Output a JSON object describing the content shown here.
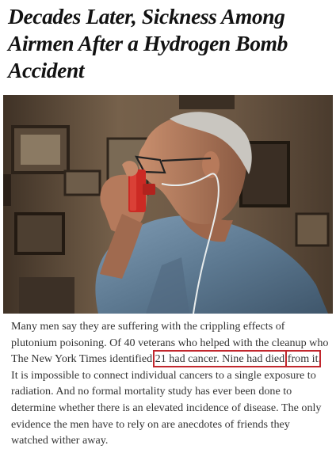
{
  "article": {
    "headline": "Decades Later, Sickness Among Airmen After a Hydrogen Bomb Accident",
    "photo": {
      "subject": "older-man-using-inhaler",
      "icon": "inhaler-icon",
      "colors": {
        "background": "#5e4a38",
        "shirt": "#5f7b93",
        "inhaler": "#cc2a24",
        "highlight_box": "#c1272d"
      }
    },
    "body": {
      "text_before": "Many men say they are suffering with the crippling effects of plutonium poisoning. Of 40 veterans who helped with the cleanup who The New York Times identified ",
      "highlight_1": "21 had cancer. Nine had died",
      "text_between": " ",
      "highlight_2": "from it",
      "text_after": ". It is impossible to connect individual cancers to a single exposure to radiation. And no formal mortality study has ever been done to determine whether there is an elevated incidence of disease. The only evidence the men have to rely on are anecdotes of friends they watched wither away."
    }
  }
}
